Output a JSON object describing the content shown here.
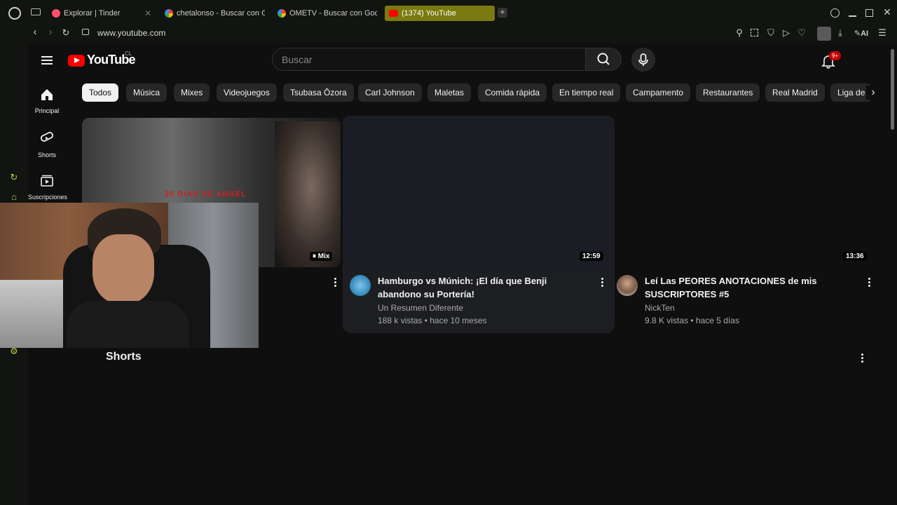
{
  "browser": {
    "tabs": [
      {
        "title": "Explorar | Tinder",
        "active": false
      },
      {
        "title": "chetalonso - Buscar con G",
        "active": false
      },
      {
        "title": "OMETV - Buscar con Goo",
        "active": false
      },
      {
        "title": "(1374) YouTube",
        "active": true
      }
    ],
    "url": "www.youtube.com",
    "ai_label": "AI"
  },
  "youtube": {
    "logo_text": "YouTube",
    "region": "CL",
    "search_placeholder": "Buscar",
    "notification_count": "9+",
    "guide": [
      {
        "label": "Principal",
        "icon": "home-icon"
      },
      {
        "label": "Shorts",
        "icon": "shorts-icon"
      },
      {
        "label": "Suscripciones",
        "icon": "subscriptions-icon"
      }
    ],
    "chips": [
      "Todos",
      "Música",
      "Mixes",
      "Videojuegos",
      "Tsubasa Ōzora",
      "Carl Johnson",
      "Maletas",
      "Comida rápida",
      "En tiempo real",
      "Campamento",
      "Restaurantes",
      "Real Madrid",
      "Liga de"
    ],
    "videos": [
      {
        "title": "",
        "channel": "",
        "meta": "",
        "badge": "Mix",
        "thumb_text": "20 DIAS DE ANGEL"
      },
      {
        "title": "Hamburgo vs Múnich: ¡El día que Benji abandono su Portería!",
        "channel": "Un Resumen Diferente",
        "meta": "188 k vistas • hace 10 meses",
        "duration": "12:59"
      },
      {
        "title": "Leí Las PEORES ANOTACIONES de mis SUSCRIPTORES #5",
        "channel": "NickTen",
        "meta": "9.8 K vistas • hace 5 días",
        "duration": "13:36"
      }
    ],
    "shorts_heading": "Shorts"
  },
  "colors": {
    "background": "#0f0f0f",
    "active_tab": "#7a7a10",
    "brand_red": "#ff0000"
  }
}
